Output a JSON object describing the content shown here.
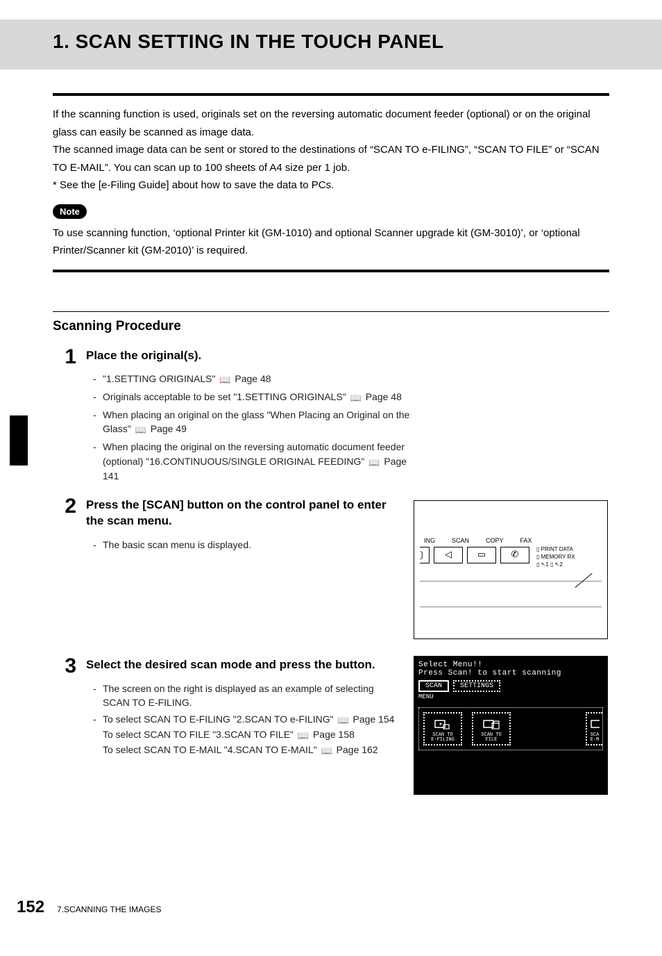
{
  "header": {
    "title": "1. SCAN SETTING IN THE TOUCH PANEL"
  },
  "intro": {
    "p1": "If the scanning function is used, originals set on the reversing automatic document feeder (optional) or on the original glass can easily be scanned as image data.",
    "p2": "The scanned image data can be sent or stored to the destinations of “SCAN TO e-FILING”, “SCAN TO FILE” or “SCAN TO E-MAIL”. You can scan up to 100 sheets of A4 size per 1 job.",
    "p3": "*  See the [e-Filing Guide] about how to save the data to PCs."
  },
  "note": {
    "label": "Note",
    "text": "To use scanning function, ‘optional Printer kit (GM-1010) and optional Scanner upgrade kit (GM-3010)’, or ‘optional Printer/Scanner kit (GM-2010)’ is required."
  },
  "section": {
    "title": "Scanning Procedure"
  },
  "steps": {
    "s1": {
      "num": "1",
      "title": "Place the original(s).",
      "b1a": "\"1.SETTING ORIGINALS\" ",
      "b1b": " Page 48",
      "b2a": "Originals acceptable to be set \"1.SETTING ORIGINALS\" ",
      "b2b": " Page 48",
      "b3a": "When placing an original on the glass \"When Placing an Original on the Glass\" ",
      "b3b": " Page 49",
      "b4a": "When placing the original on the reversing automatic document feeder (optional) \"16.CONTINUOUS/SINGLE ORIGINAL FEEDING\" ",
      "b4b": " Page 141"
    },
    "s2": {
      "num": "2",
      "title": "Press the [SCAN] button on the control panel to enter the scan menu.",
      "b1": "The basic scan menu is displayed."
    },
    "s3": {
      "num": "3",
      "title": "Select the desired scan mode and press the button.",
      "b1": "The screen on the right is displayed as an example of selecting SCAN TO E-FILING.",
      "b2a": "To select SCAN TO E-FILING \"2.SCAN TO e-FILING\" ",
      "b2b": " Page 154",
      "b3a": "To select SCAN TO FILE \"3.SCAN TO FILE\" ",
      "b3b": " Page 158",
      "b4a": "To select SCAN TO E-MAIL \"4.SCAN TO E-MAIL\" ",
      "b4b": " Page 162"
    }
  },
  "panel1": {
    "labels": {
      "a": "ING",
      "b": "SCAN",
      "c": "COPY",
      "d": "FAX"
    },
    "side": {
      "a": "PRINT DATA",
      "b": "MEMORY RX",
      "c": "L1",
      "d": "L2"
    }
  },
  "panel2": {
    "l1": "Select Menu!!",
    "l2": "Press Scan! to start scanning",
    "tab1": "SCAN",
    "tab2": "SETTINGS",
    "menu": "MENU",
    "icon1a": "SCAN TO",
    "icon1b": "E-FILING",
    "icon2a": "SCAN TO",
    "icon2b": "FILE",
    "icon3a": "SCA",
    "icon3b": "E-M"
  },
  "footer": {
    "page": "152",
    "chapter": "7.SCANNING THE IMAGES"
  }
}
